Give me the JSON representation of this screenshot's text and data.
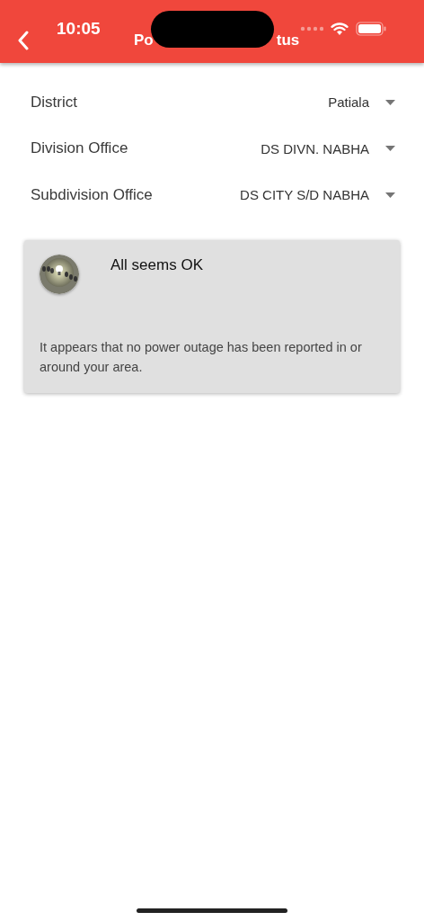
{
  "status_bar": {
    "time": "10:05"
  },
  "app_bar": {
    "title_parts": [
      "Po",
      "tus"
    ]
  },
  "filters": [
    {
      "label": "District",
      "value": "Patiala"
    },
    {
      "label": "Division Office",
      "value": "DS DIVN. NABHA"
    },
    {
      "label": "Subdivision Office",
      "value": "DS CITY S/D NABHA"
    }
  ],
  "status_card": {
    "title": "All seems OK",
    "message": "It appears that no power outage has been reported in or around your area."
  }
}
